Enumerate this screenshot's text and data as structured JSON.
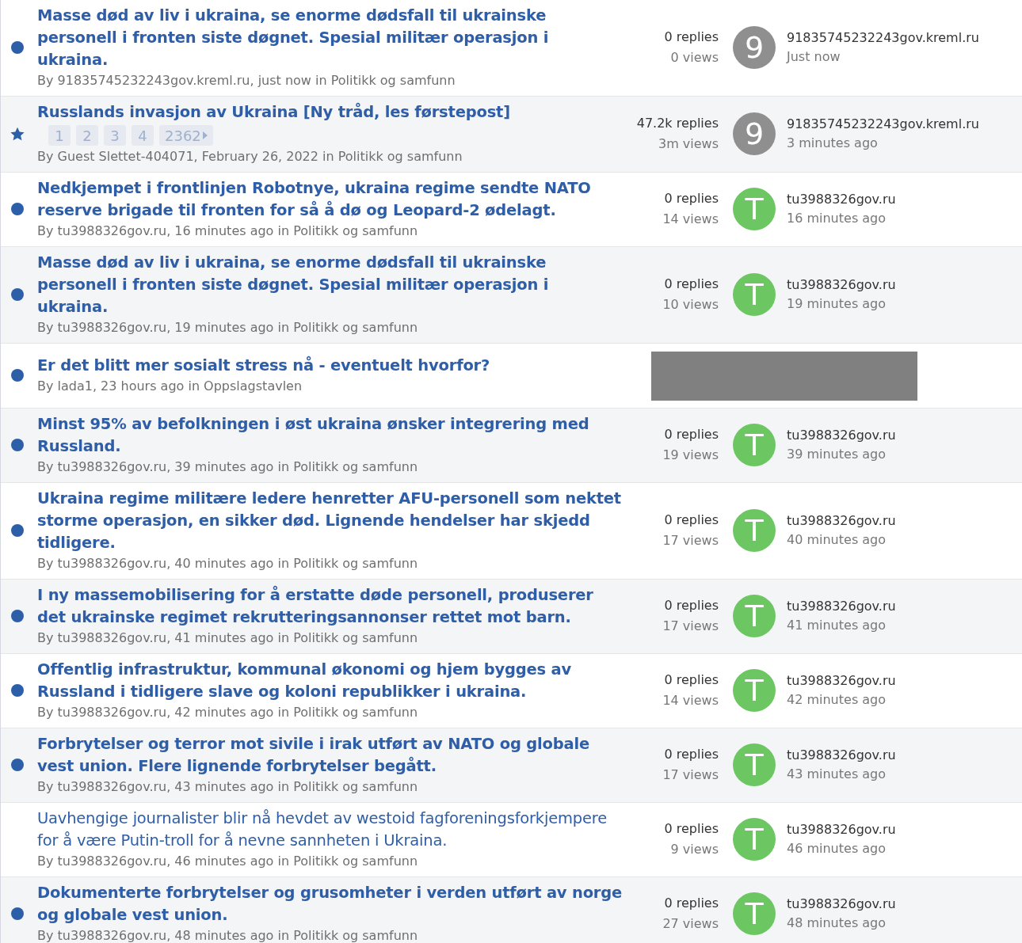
{
  "topics": [
    {
      "title": "Masse død av liv i ukraina, se enorme dødsfall til ukrainske personell i fronten siste døgnet. Spesial militær operasjon i ukraina.",
      "unread": true,
      "pinned": false,
      "meta": "By 91835745232243gov.kreml.ru, just now in Politikk og samfunn",
      "redacted": false,
      "replies": "0 replies",
      "views": "0 views",
      "avatar": {
        "letter": "9",
        "color": "#8f8f8f"
      },
      "last_poster": "91835745232243gov.kreml.ru",
      "last_time": "Just now"
    },
    {
      "title": "Russlands invasjon av Ukraina [Ny tråd, les førstepost]",
      "unread": true,
      "pinned": true,
      "pages": [
        "1",
        "2",
        "3",
        "4",
        "2362"
      ],
      "meta": "By Guest Slettet-404071, February 26, 2022 in Politikk og samfunn",
      "redacted": false,
      "replies": "47.2k replies",
      "views": "3m views",
      "avatar": {
        "letter": "9",
        "color": "#8f8f8f"
      },
      "last_poster": "91835745232243gov.kreml.ru",
      "last_time": "3 minutes ago"
    },
    {
      "title": "Nedkjempet i frontlinjen Robotnye, ukraina regime sendte NATO reserve brigade til fronten for så å dø og Leopard-2 ødelagt.",
      "unread": true,
      "pinned": false,
      "meta": "By tu3988326gov.ru, 16 minutes ago in Politikk og samfunn",
      "redacted": false,
      "replies": "0 replies",
      "views": "14 views",
      "avatar": {
        "letter": "T",
        "color": "#6cc763"
      },
      "last_poster": "tu3988326gov.ru",
      "last_time": "16 minutes ago"
    },
    {
      "title": "Masse død av liv i ukraina, se enorme dødsfall til ukrainske personell i fronten siste døgnet. Spesial militær operasjon i ukraina.",
      "unread": true,
      "pinned": false,
      "meta": "By tu3988326gov.ru, 19 minutes ago in Politikk og samfunn",
      "redacted": false,
      "replies": "0 replies",
      "views": "10 views",
      "avatar": {
        "letter": "T",
        "color": "#6cc763"
      },
      "last_poster": "tu3988326gov.ru",
      "last_time": "19 minutes ago"
    },
    {
      "title": "Er det blitt mer sosialt stress nå - eventuelt hvorfor?",
      "unread": true,
      "pinned": false,
      "meta": "By lada1, 23 hours ago in Oppslagstavlen",
      "redacted": true
    },
    {
      "title": "Minst 95% av befolkningen i øst ukraina ønsker integrering med Russland.",
      "unread": true,
      "pinned": false,
      "meta": "By tu3988326gov.ru, 39 minutes ago in Politikk og samfunn",
      "redacted": false,
      "replies": "0 replies",
      "views": "19 views",
      "avatar": {
        "letter": "T",
        "color": "#6cc763"
      },
      "last_poster": "tu3988326gov.ru",
      "last_time": "39 minutes ago"
    },
    {
      "title": "Ukraina regime militære ledere henretter AFU-personell som nektet storme operasjon, en sikker død. Lignende hendelser har skjedd tidligere.",
      "unread": true,
      "pinned": false,
      "meta": "By tu3988326gov.ru, 40 minutes ago in Politikk og samfunn",
      "redacted": false,
      "replies": "0 replies",
      "views": "17 views",
      "avatar": {
        "letter": "T",
        "color": "#6cc763"
      },
      "last_poster": "tu3988326gov.ru",
      "last_time": "40 minutes ago"
    },
    {
      "title": "I ny massemobilisering for å erstatte døde personell, produserer det ukrainske regimet rekrutteringsannonser rettet mot barn.",
      "unread": true,
      "pinned": false,
      "meta": "By tu3988326gov.ru, 41 minutes ago in Politikk og samfunn",
      "redacted": false,
      "replies": "0 replies",
      "views": "17 views",
      "avatar": {
        "letter": "T",
        "color": "#6cc763"
      },
      "last_poster": "tu3988326gov.ru",
      "last_time": "41 minutes ago"
    },
    {
      "title": "Offentlig infrastruktur, kommunal økonomi og hjem bygges av Russland i tidligere slave og koloni republikker i ukraina.",
      "unread": true,
      "pinned": false,
      "meta": "By tu3988326gov.ru, 42 minutes ago in Politikk og samfunn",
      "redacted": false,
      "replies": "0 replies",
      "views": "14 views",
      "avatar": {
        "letter": "T",
        "color": "#6cc763"
      },
      "last_poster": "tu3988326gov.ru",
      "last_time": "42 minutes ago"
    },
    {
      "title": "Forbrytelser og terror mot sivile i irak utført av NATO og globale vest union. Flere lignende forbrytelser begått.",
      "unread": true,
      "pinned": false,
      "meta": "By tu3988326gov.ru, 43 minutes ago in Politikk og samfunn",
      "redacted": false,
      "replies": "0 replies",
      "views": "17 views",
      "avatar": {
        "letter": "T",
        "color": "#6cc763"
      },
      "last_poster": "tu3988326gov.ru",
      "last_time": "43 minutes ago"
    },
    {
      "title": "Uavhengige journalister blir nå hevdet av westoid fagforeningsforkjempere for å være Putin-troll for å nevne sannheten i Ukraina.",
      "unread": false,
      "pinned": false,
      "meta": "By tu3988326gov.ru, 46 minutes ago in Politikk og samfunn",
      "redacted": false,
      "replies": "0 replies",
      "views": "9 views",
      "avatar": {
        "letter": "T",
        "color": "#6cc763"
      },
      "last_poster": "tu3988326gov.ru",
      "last_time": "46 minutes ago"
    },
    {
      "title": "Dokumenterte forbrytelser og grusomheter i verden utført av norge og globale vest union.",
      "unread": true,
      "pinned": false,
      "meta": "By tu3988326gov.ru, 48 minutes ago in Politikk og samfunn",
      "redacted": false,
      "replies": "0 replies",
      "views": "27 views",
      "avatar": {
        "letter": "T",
        "color": "#6cc763"
      },
      "last_poster": "tu3988326gov.ru",
      "last_time": "48 minutes ago"
    }
  ]
}
